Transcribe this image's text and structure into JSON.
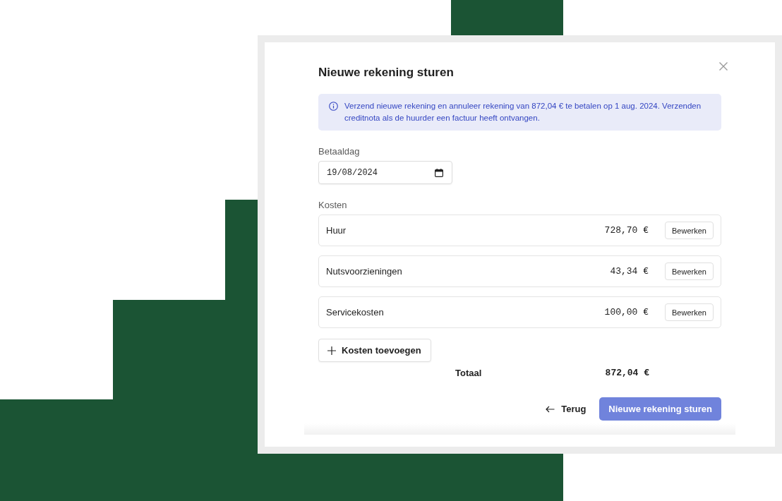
{
  "dialog": {
    "title": "Nieuwe rekening sturen",
    "info": "Verzend nieuwe rekening en annuleer rekening van 872,04 € te betalen op 1 aug. 2024. Verzenden creditnota als de huurder een factuur heeft ontvangen.",
    "payment_day": {
      "label": "Betaaldag",
      "value": "19/08/2024"
    },
    "costs": {
      "label": "Kosten",
      "items": [
        {
          "name": "Huur",
          "amount": "728,70 €",
          "action": "Bewerken"
        },
        {
          "name": "Nutsvoorzieningen",
          "amount": "43,34 €",
          "action": "Bewerken"
        },
        {
          "name": "Servicekosten",
          "amount": "100,00 €",
          "action": "Bewerken"
        }
      ],
      "add_button": "Kosten toevoegen",
      "total_label": "Totaal",
      "total_amount": "872,04 €"
    },
    "footer": {
      "back_button": "Terug",
      "submit_button": "Nieuwe rekening sturen"
    }
  }
}
